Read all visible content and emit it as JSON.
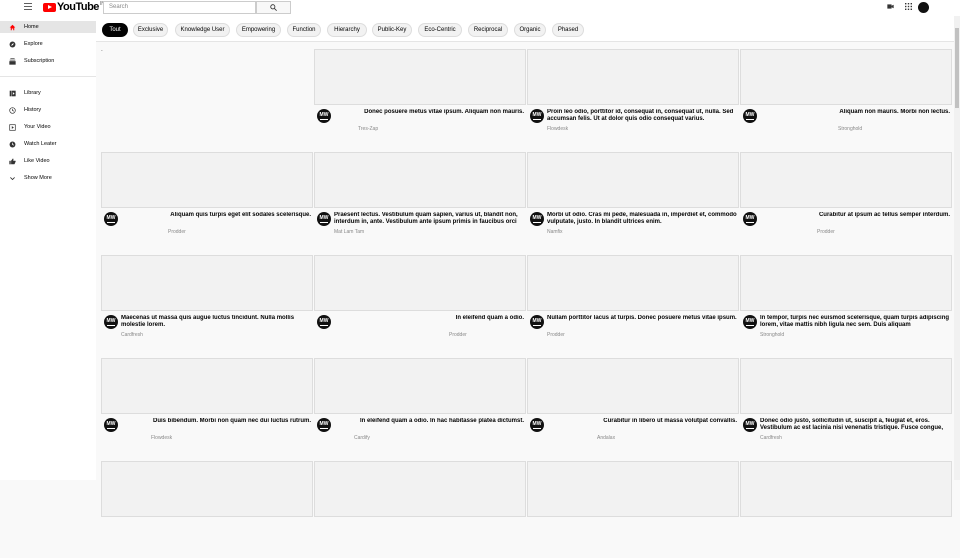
{
  "header": {
    "logo_text": "YouTube",
    "region": "IN",
    "search_placeholder": "Search"
  },
  "sidebar": {
    "items": [
      {
        "label": "Home",
        "icon": "home-icon",
        "active": true
      },
      {
        "label": "Explore",
        "icon": "compass-icon",
        "active": false
      },
      {
        "label": "Subscription",
        "icon": "subscriptions-icon",
        "active": false
      },
      {
        "label": "Library",
        "icon": "library-icon",
        "active": false
      },
      {
        "label": "History",
        "icon": "history-icon",
        "active": false
      },
      {
        "label": "Your Video",
        "icon": "your-video-icon",
        "active": false
      },
      {
        "label": "Watch Leater",
        "icon": "clock-icon",
        "active": false
      },
      {
        "label": "Like Video",
        "icon": "thumbs-up-icon",
        "active": false
      },
      {
        "label": "Show More",
        "icon": "chevron-down-icon",
        "active": false
      }
    ]
  },
  "chips": [
    "Tout",
    "Exclusive",
    "Knowledge User",
    "Empowering",
    "Function",
    "Hierarchy",
    "Public-Key",
    "Eco-Centric",
    "Reciprocal",
    "Organic",
    "Phased"
  ],
  "avatar_text": "MW",
  "videos": [
    {
      "title": "",
      "channel": ""
    },
    {
      "title": "Donec posuere metus vitae ipsum. Aliquam non mauris.",
      "channel": "Tres-Zap"
    },
    {
      "title": "Proin leo odio, porttitor id, consequat in, consequat ut, nulla. Sed accumsan felis. Ut at dolor quis odio consequat varius.",
      "channel": "Flowdesk"
    },
    {
      "title": "Aliquam non mauris. Morbi non lectus.",
      "channel": "Stronghold"
    },
    {
      "title": "Aliquam quis turpis eget elit sodales scelerisque.",
      "channel": "Prodder"
    },
    {
      "title": "Praesent lectus. Vestibulum quam sapien, varius ut, blandit non, interdum in, ante. Vestibulum ante ipsum primis in faucibus orci",
      "channel": "Mat Lam Tam"
    },
    {
      "title": "Morbi ut odio. Cras mi pede, malesuada in, imperdiet et, commodo vulputate, justo. In blandit ultrices enim.",
      "channel": "Namfix"
    },
    {
      "title": "Curabitur at ipsum ac tellus semper interdum.",
      "channel": "Prodder"
    },
    {
      "title": "Maecenas ut massa quis augue luctus tincidunt. Nulla mollis molestie lorem.",
      "channel": "Cardfresh"
    },
    {
      "title": "In eleifend quam a odio.",
      "channel": "Prodder"
    },
    {
      "title": "Nullam porttitor lacus at turpis. Donec posuere metus vitae ipsum.",
      "channel": "Prodder"
    },
    {
      "title": "In tempor, turpis nec euismod scelerisque, quam turpis adipiscing lorem, vitae mattis nibh ligula nec sem. Duis aliquam",
      "channel": "Stronghold"
    },
    {
      "title": "Duis bibendum. Morbi non quam nec dui luctus rutrum.",
      "channel": "Flowdesk"
    },
    {
      "title": "In eleifend quam a odio. In hac habitasse platea dictumst.",
      "channel": "Cardify"
    },
    {
      "title": "Curabitur in libero ut massa volutpat convallis.",
      "channel": "Andalax"
    },
    {
      "title": "Donec odio justo, sollicitudin ut, suscipit a, feugiat et, eros. Vestibulum ac est lacinia nisi venenatis tristique. Fusce congue,",
      "channel": "Cardfresh"
    }
  ]
}
